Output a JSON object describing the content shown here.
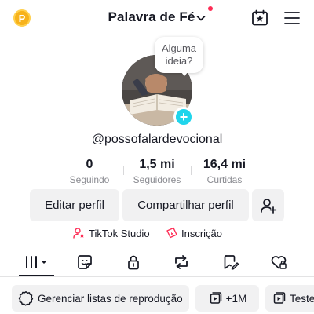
{
  "header": {
    "coin_letter": "P",
    "title": "Palavra de Fé",
    "icons": [
      "coin-icon",
      "chevron-down-icon",
      "notification-dot",
      "calendar-star-icon",
      "menu-icon"
    ]
  },
  "profile": {
    "bubble_text_1": "Alguma",
    "bubble_text_2": "ideia?",
    "username": "@possofalardevocional"
  },
  "stats": [
    {
      "value": "0",
      "label": "Seguindo"
    },
    {
      "value": "1,5 mi",
      "label": "Seguidores"
    },
    {
      "value": "16,4 mi",
      "label": "Curtidas"
    }
  ],
  "actions": {
    "edit": "Editar perfil",
    "share": "Compartilhar perfil"
  },
  "links": {
    "studio": "TikTok Studio",
    "subscription": "Inscrição"
  },
  "tabs": [
    "videos-grid-icon",
    "stickers-icon",
    "lock-icon",
    "repost-icon",
    "bookmark-icon",
    "liked-icon"
  ],
  "chips": {
    "playlists": "Gerenciar listas de reprodução",
    "views": "+1M",
    "test": "Teste"
  },
  "colors": {
    "accent": "#fe2c55",
    "plus": "#20d5ec",
    "coin": "#f7b21b",
    "button_bg": "#f1f1f2"
  }
}
